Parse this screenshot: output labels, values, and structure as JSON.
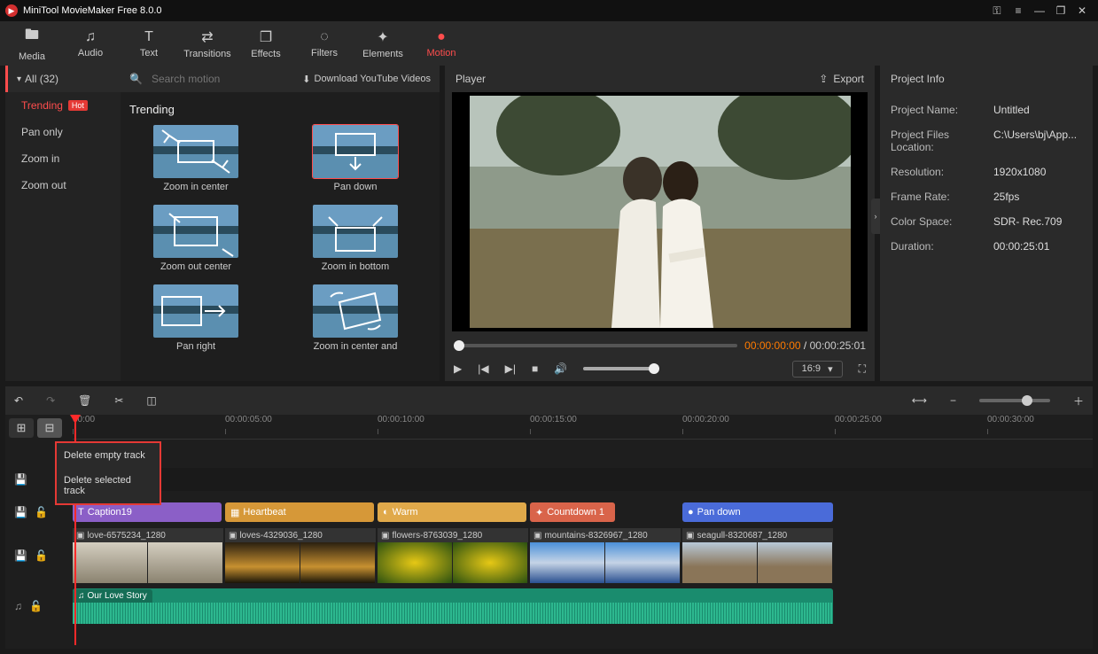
{
  "app": {
    "title": "MiniTool MovieMaker Free 8.0.0"
  },
  "toolbar": {
    "media": "Media",
    "audio": "Audio",
    "text": "Text",
    "transitions": "Transitions",
    "effects": "Effects",
    "filters": "Filters",
    "elements": "Elements",
    "motion": "Motion"
  },
  "library": {
    "all_label": "All (32)",
    "categories": {
      "trending": "Trending",
      "pan_only": "Pan only",
      "zoom_in": "Zoom in",
      "zoom_out": "Zoom out"
    },
    "hot_badge": "Hot",
    "search_placeholder": "Search motion",
    "download_label": "Download YouTube Videos",
    "section_title": "Trending",
    "items": [
      "Zoom in center",
      "Pan down",
      "Zoom out center",
      "Zoom in bottom",
      "Pan right",
      "Zoom in center and"
    ]
  },
  "player": {
    "title": "Player",
    "export": "Export",
    "current_time": "00:00:00:00",
    "total_time": "00:00:25:01",
    "aspect": "16:9"
  },
  "info": {
    "title": "Project Info",
    "rows": {
      "name_k": "Project Name:",
      "name_v": "Untitled",
      "loc_k": "Project Files Location:",
      "loc_v": "C:\\Users\\bj\\App...",
      "res_k": "Resolution:",
      "res_v": "1920x1080",
      "fps_k": "Frame Rate:",
      "fps_v": "25fps",
      "cs_k": "Color Space:",
      "cs_v": "SDR- Rec.709",
      "dur_k": "Duration:",
      "dur_v": "00:00:25:01"
    }
  },
  "ruler": [
    "00:00",
    "00:00:05:00",
    "00:00:10:00",
    "00:00:15:00",
    "00:00:20:00",
    "00:00:25:00",
    "00:00:30:00"
  ],
  "context_menu": {
    "delete_empty": "Delete empty track",
    "delete_selected": "Delete selected track"
  },
  "overlay_clips": {
    "caption": "Caption19",
    "heartbeat": "Heartbeat",
    "warm": "Warm",
    "countdown": "Countdown 1",
    "pandown": "Pan down"
  },
  "video_clips": {
    "c1": "love-6575234_1280",
    "c2": "loves-4329036_1280",
    "c3": "flowers-8763039_1280",
    "c4": "mountains-8326967_1280",
    "c5": "seagull-8320687_1280"
  },
  "audio_clip": "Our Love Story"
}
